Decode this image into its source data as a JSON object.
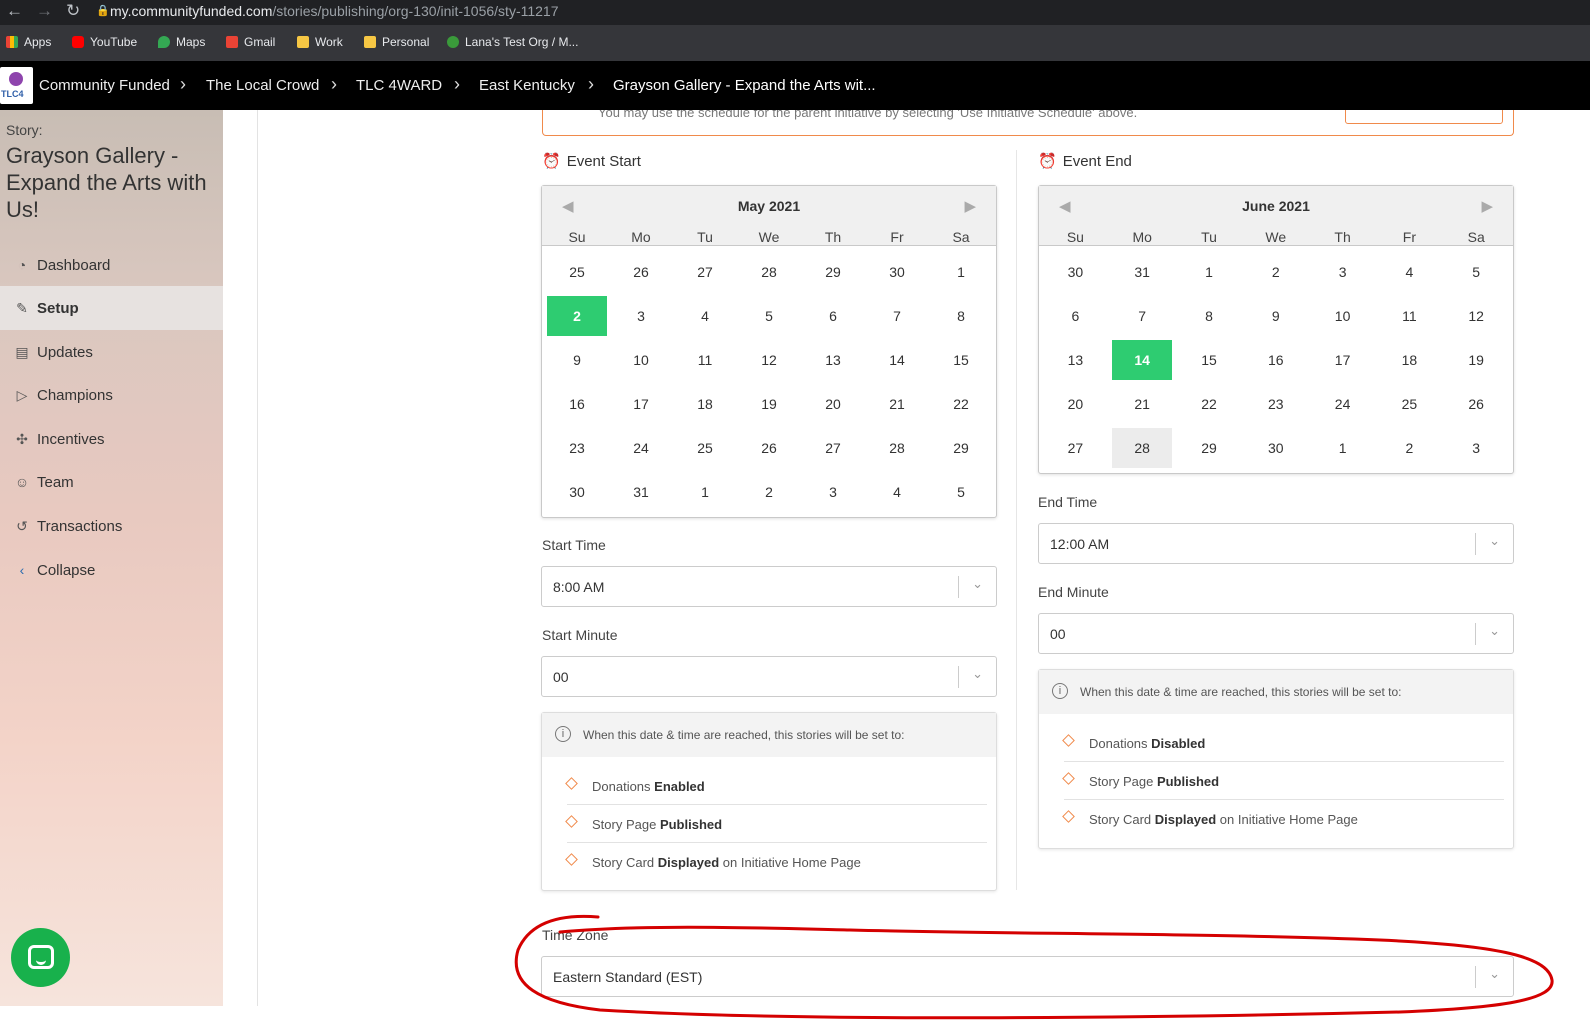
{
  "browser": {
    "url_host": "my.communityfunded.com",
    "url_path": "/stories/publishing/org-130/init-1056/sty-11217",
    "bookmarks": [
      "Apps",
      "YouTube",
      "Maps",
      "Gmail",
      "Work",
      "Personal",
      "Lana's Test Org / M..."
    ]
  },
  "breadcrumb": {
    "logo_text": "TLC4",
    "items": [
      "Community Funded",
      "The Local Crowd",
      "TLC 4WARD",
      "East Kentucky",
      "Grayson Gallery - Expand the Arts wit..."
    ]
  },
  "sidebar": {
    "label": "Story:",
    "title": "Grayson Gallery - Expand the Arts with Us!",
    "items": [
      {
        "label": "Dashboard",
        "icon": "gauge-icon"
      },
      {
        "label": "Setup",
        "icon": "edit-icon"
      },
      {
        "label": "Updates",
        "icon": "chat-icon"
      },
      {
        "label": "Champions",
        "icon": "megaphone-icon"
      },
      {
        "label": "Incentives",
        "icon": "sparkle-icon"
      },
      {
        "label": "Team",
        "icon": "team-icon"
      },
      {
        "label": "Transactions",
        "icon": "money-icon"
      },
      {
        "label": "Collapse",
        "icon": "chevron-left-icon"
      }
    ],
    "active": "Setup"
  },
  "notice": {
    "text": "You may use the schedule for the parent initiative by selecting 'Use Initiative Schedule' above."
  },
  "event_start": {
    "heading": "Event Start",
    "calendar": {
      "month": "May 2021",
      "weekdays": [
        "Su",
        "Mo",
        "Tu",
        "We",
        "Th",
        "Fr",
        "Sa"
      ],
      "days": [
        [
          "25",
          "26",
          "27",
          "28",
          "29",
          "30",
          "1"
        ],
        [
          "2",
          "3",
          "4",
          "5",
          "6",
          "7",
          "8"
        ],
        [
          "9",
          "10",
          "11",
          "12",
          "13",
          "14",
          "15"
        ],
        [
          "16",
          "17",
          "18",
          "19",
          "20",
          "21",
          "22"
        ],
        [
          "23",
          "24",
          "25",
          "26",
          "27",
          "28",
          "29"
        ],
        [
          "30",
          "31",
          "1",
          "2",
          "3",
          "4",
          "5"
        ]
      ],
      "selected": "2"
    },
    "time_label": "Start Time",
    "time_value": "8:00 AM",
    "minute_label": "Start Minute",
    "minute_value": "00",
    "info": {
      "heading": "When this date & time are reached, this stories will be set to:",
      "rows": [
        {
          "pre": "Donations ",
          "bold": "Enabled",
          "post": ""
        },
        {
          "pre": "Story Page ",
          "bold": "Published",
          "post": ""
        },
        {
          "pre": "Story Card ",
          "bold": "Displayed",
          "post": " on Initiative Home Page"
        }
      ]
    }
  },
  "event_end": {
    "heading": "Event End",
    "calendar": {
      "month": "June 2021",
      "weekdays": [
        "Su",
        "Mo",
        "Tu",
        "We",
        "Th",
        "Fr",
        "Sa"
      ],
      "days": [
        [
          "30",
          "31",
          "1",
          "2",
          "3",
          "4",
          "5"
        ],
        [
          "6",
          "7",
          "8",
          "9",
          "10",
          "11",
          "12"
        ],
        [
          "13",
          "14",
          "15",
          "16",
          "17",
          "18",
          "19"
        ],
        [
          "20",
          "21",
          "22",
          "23",
          "24",
          "25",
          "26"
        ],
        [
          "27",
          "28",
          "29",
          "30",
          "1",
          "2",
          "3"
        ]
      ],
      "selected": "14",
      "hovered": "28"
    },
    "time_label": "End Time",
    "time_value": "12:00 AM",
    "minute_label": "End Minute",
    "minute_value": "00",
    "info": {
      "heading": "When this date & time are reached, this stories will be set to:",
      "rows": [
        {
          "pre": "Donations ",
          "bold": "Disabled",
          "post": ""
        },
        {
          "pre": "Story Page ",
          "bold": "Published",
          "post": ""
        },
        {
          "pre": "Story Card ",
          "bold": "Displayed",
          "post": " on Initiative Home Page"
        }
      ]
    }
  },
  "timezone": {
    "label": "Time Zone",
    "value": "Eastern Standard (EST)"
  },
  "colors": {
    "accent_green": "#2ecc71",
    "accent_orange": "#f08a4b",
    "annotation_red": "#d40000",
    "chat_green": "#18b14c"
  }
}
